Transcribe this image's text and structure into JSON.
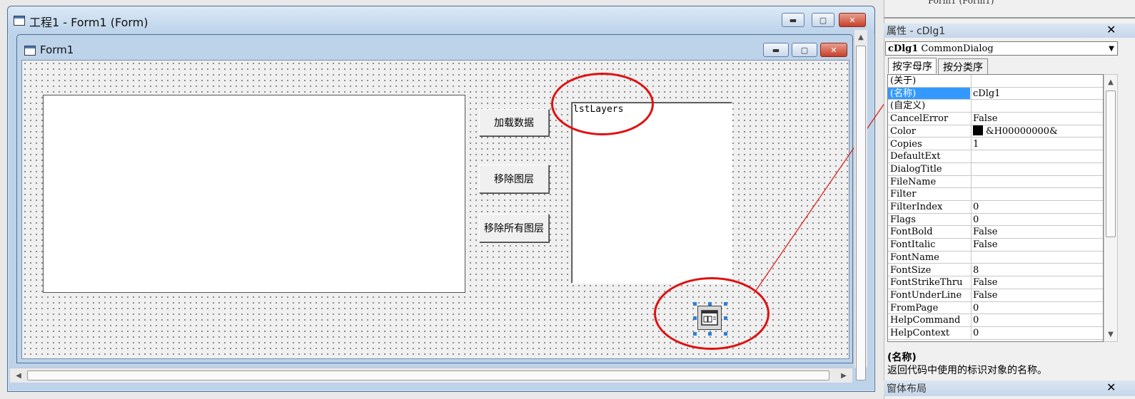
{
  "outer_window": {
    "title": "工程1 - Form1 (Form)"
  },
  "inner_window": {
    "title": "Form1"
  },
  "caption_buttons": {
    "minimize": "▬",
    "maximize": "▢",
    "close": "✕"
  },
  "form": {
    "buttons": [
      {
        "label": "加载数据"
      },
      {
        "label": "移除图层"
      },
      {
        "label": "移除所有图层"
      }
    ],
    "listbox_name": "lstLayers"
  },
  "properties_panel": {
    "title": "属性 - cDlg1",
    "object_name": "cDlg1",
    "object_type": "CommonDialog",
    "tabs": [
      "按字母序",
      "按分类序"
    ],
    "rows": [
      {
        "name": "(关于)",
        "value": ""
      },
      {
        "name": "(名称)",
        "value": "cDlg1",
        "selected": true
      },
      {
        "name": "(自定义)",
        "value": ""
      },
      {
        "name": "CancelError",
        "value": "False"
      },
      {
        "name": "Color",
        "value": "&H00000000&",
        "swatch": "#000000"
      },
      {
        "name": "Copies",
        "value": "1"
      },
      {
        "name": "DefaultExt",
        "value": ""
      },
      {
        "name": "DialogTitle",
        "value": ""
      },
      {
        "name": "FileName",
        "value": ""
      },
      {
        "name": "Filter",
        "value": ""
      },
      {
        "name": "FilterIndex",
        "value": "0"
      },
      {
        "name": "Flags",
        "value": "0"
      },
      {
        "name": "FontBold",
        "value": "False"
      },
      {
        "name": "FontItalic",
        "value": "False"
      },
      {
        "name": "FontName",
        "value": ""
      },
      {
        "name": "FontSize",
        "value": "8"
      },
      {
        "name": "FontStrikeThru",
        "value": "False"
      },
      {
        "name": "FontUnderLine",
        "value": "False"
      },
      {
        "name": "FromPage",
        "value": "0"
      },
      {
        "name": "HelpCommand",
        "value": "0"
      },
      {
        "name": "HelpContext",
        "value": "0"
      }
    ],
    "description_title": "(名称)",
    "description_text": "返回代码中使用的标识对象的名称。",
    "top_tree_fragment": "Form1 (Form1)",
    "next_panel_title": "窗体布局"
  },
  "colors": {
    "annotation": "#e01010",
    "selection": "#3399ff",
    "close_button": "#c7402a"
  }
}
